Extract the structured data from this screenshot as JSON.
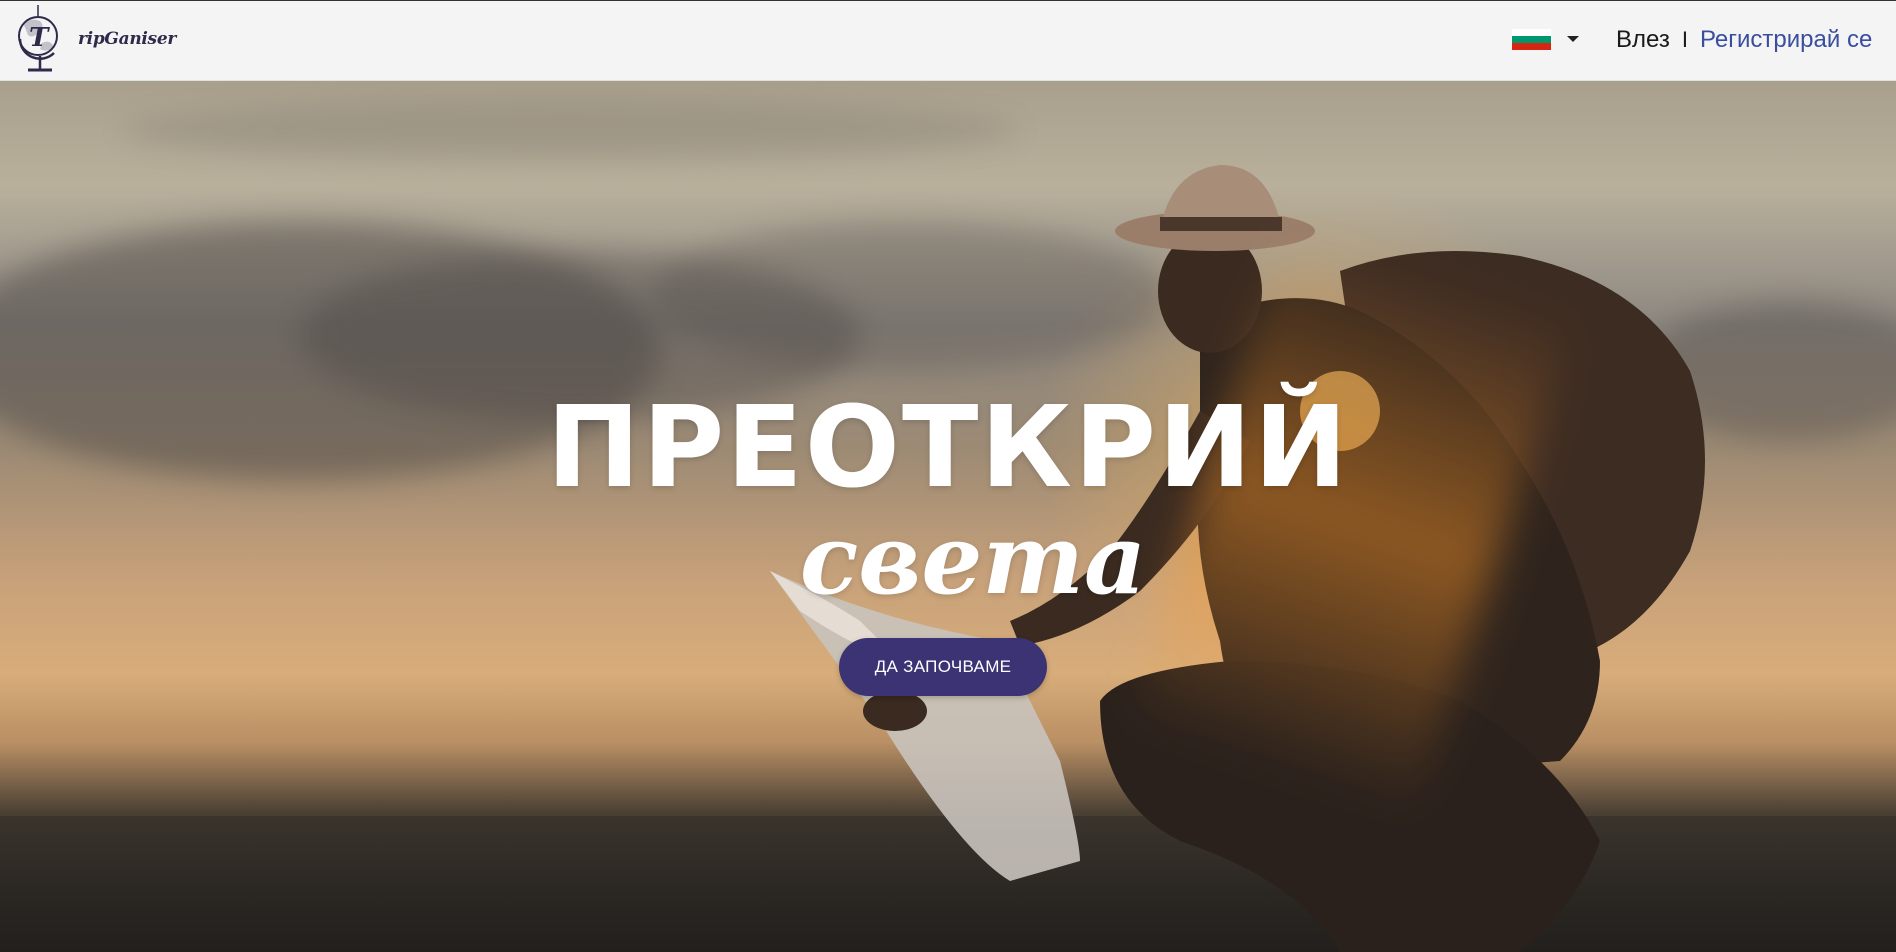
{
  "header": {
    "logo": {
      "text": "ripGaniser",
      "icon": "globe-icon"
    },
    "language": {
      "selected": "Bulgarian",
      "flag_colors": [
        "#ffffff",
        "#00966e",
        "#d62612"
      ],
      "caret_icon": "caret-down-icon"
    },
    "auth": {
      "login_label": "Влез",
      "separator": "I",
      "register_label": "Регистрирай се"
    }
  },
  "hero": {
    "title": "ПРЕОТКРИЙ",
    "subtitle": "света",
    "cta_label": "ДА ЗАПОЧВАМЕ"
  },
  "colors": {
    "accent": "#3c3374",
    "link": "#3a4ea0",
    "header_bg": "#f4f4f4"
  }
}
